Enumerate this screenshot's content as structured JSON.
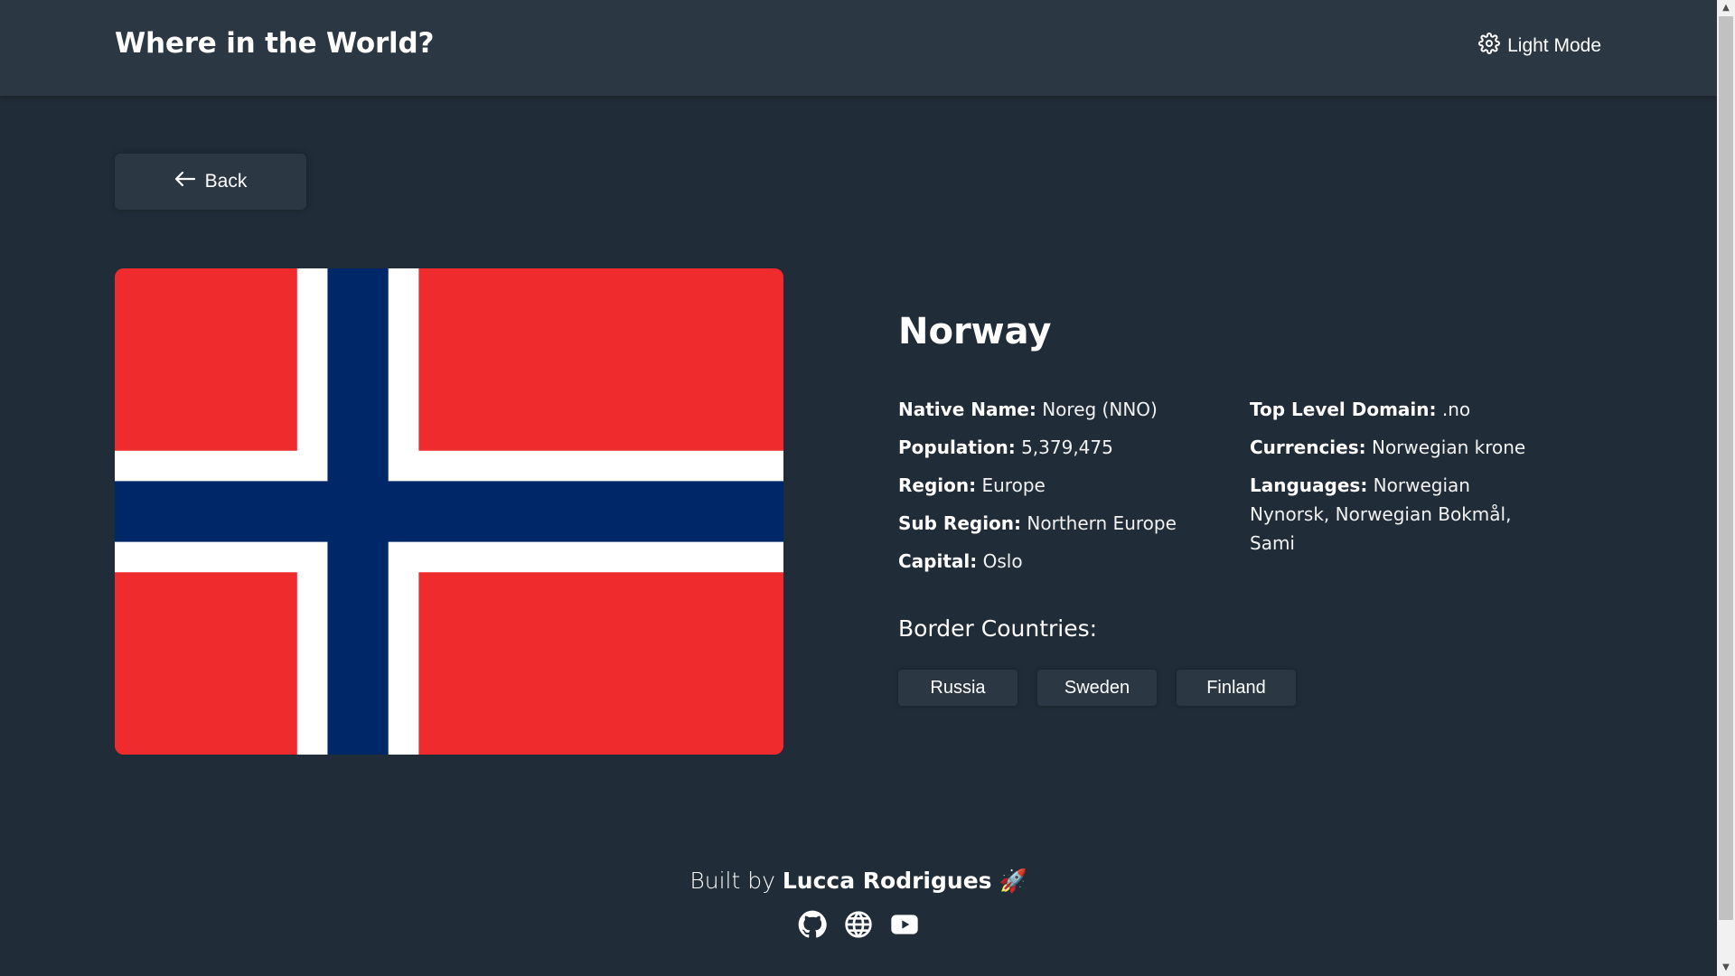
{
  "header": {
    "title": "Where in the World?",
    "theme_toggle_label": "Light Mode",
    "theme_icon": "gear-icon"
  },
  "navigation": {
    "back_label": "Back",
    "back_icon": "arrow-left-icon"
  },
  "country": {
    "name": "Norway",
    "flag": {
      "colors": {
        "red": "#ef2b2d",
        "white": "#ffffff",
        "blue": "#002868"
      }
    },
    "details_left": [
      {
        "label": "Native Name:",
        "value": "Noreg (NNO)"
      },
      {
        "label": "Population:",
        "value": "5,379,475"
      },
      {
        "label": "Region:",
        "value": "Europe"
      },
      {
        "label": "Sub Region:",
        "value": "Northern Europe"
      },
      {
        "label": "Capital:",
        "value": "Oslo"
      }
    ],
    "details_right": [
      {
        "label": "Top Level Domain:",
        "value": ".no"
      },
      {
        "label": "Currencies:",
        "value": "Norwegian krone"
      },
      {
        "label": "Languages:",
        "value": "Norwegian Nynorsk, Norwegian Bokmål, Sami"
      }
    ],
    "border_title": "Border Countries:",
    "border_countries": [
      "Russia",
      "Sweden",
      "Finland"
    ]
  },
  "footer": {
    "credit_prefix": "Built by",
    "author": "Lucca Rodrigues",
    "emoji": "🚀",
    "links": [
      {
        "name": "github-icon"
      },
      {
        "name": "globe-icon"
      },
      {
        "name": "youtube-icon"
      }
    ]
  },
  "theme": {
    "background": "#202c37",
    "elements": "#2b3743",
    "text": "#ffffff"
  }
}
